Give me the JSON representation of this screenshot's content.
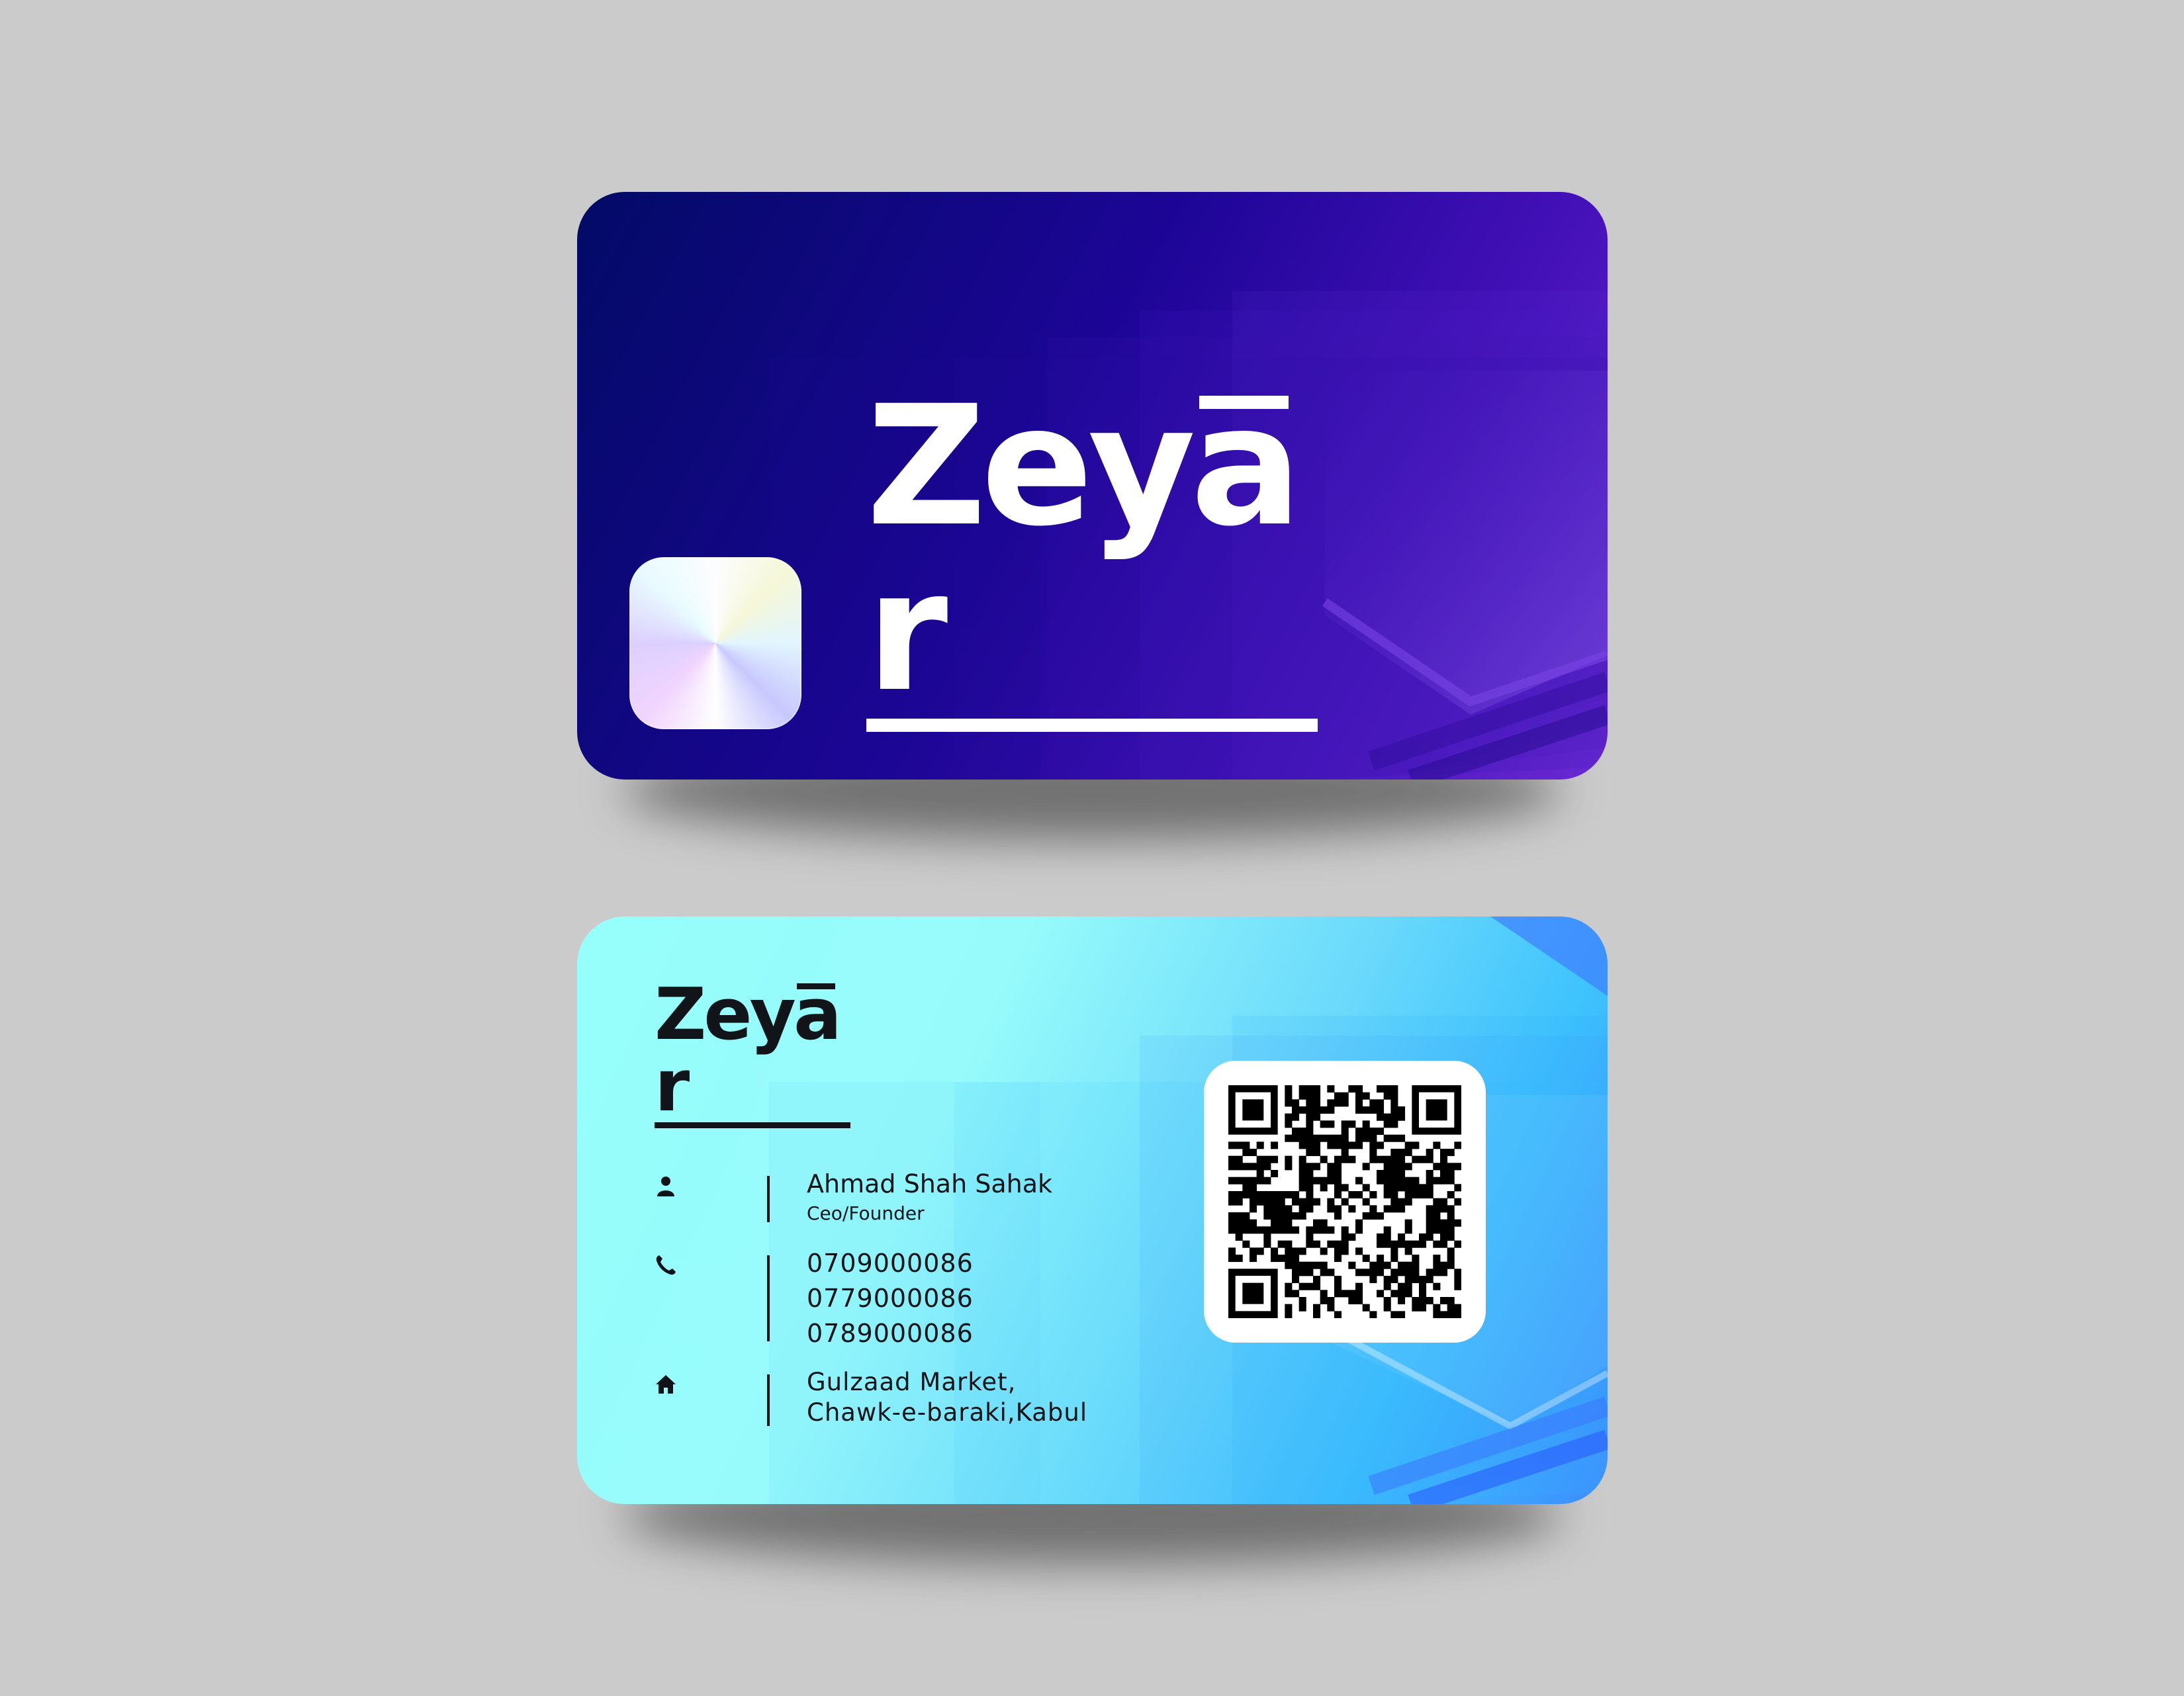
{
  "front": {
    "brand": "Zeyar",
    "brand_display": "Zeyār"
  },
  "back": {
    "brand": "Zeyar",
    "contact": {
      "name": "Ahmad Shah Sahak",
      "title": "Ceo/Founder",
      "phones": [
        "0709000086",
        "0779000086",
        "0789000086"
      ],
      "address_line1": "Gulzaad Market,",
      "address_line2": "Chawk-e-baraki,Kabul"
    },
    "icons": [
      "person-icon",
      "phone-icon",
      "home-icon",
      "qr-code"
    ]
  },
  "colors": {
    "background": "#cbcbcb",
    "front_dark": "#020a66",
    "front_accent": "#6a2ad4",
    "back_light": "#96fefb",
    "back_accent": "#3d8cfd",
    "text_dark": "#101418"
  }
}
